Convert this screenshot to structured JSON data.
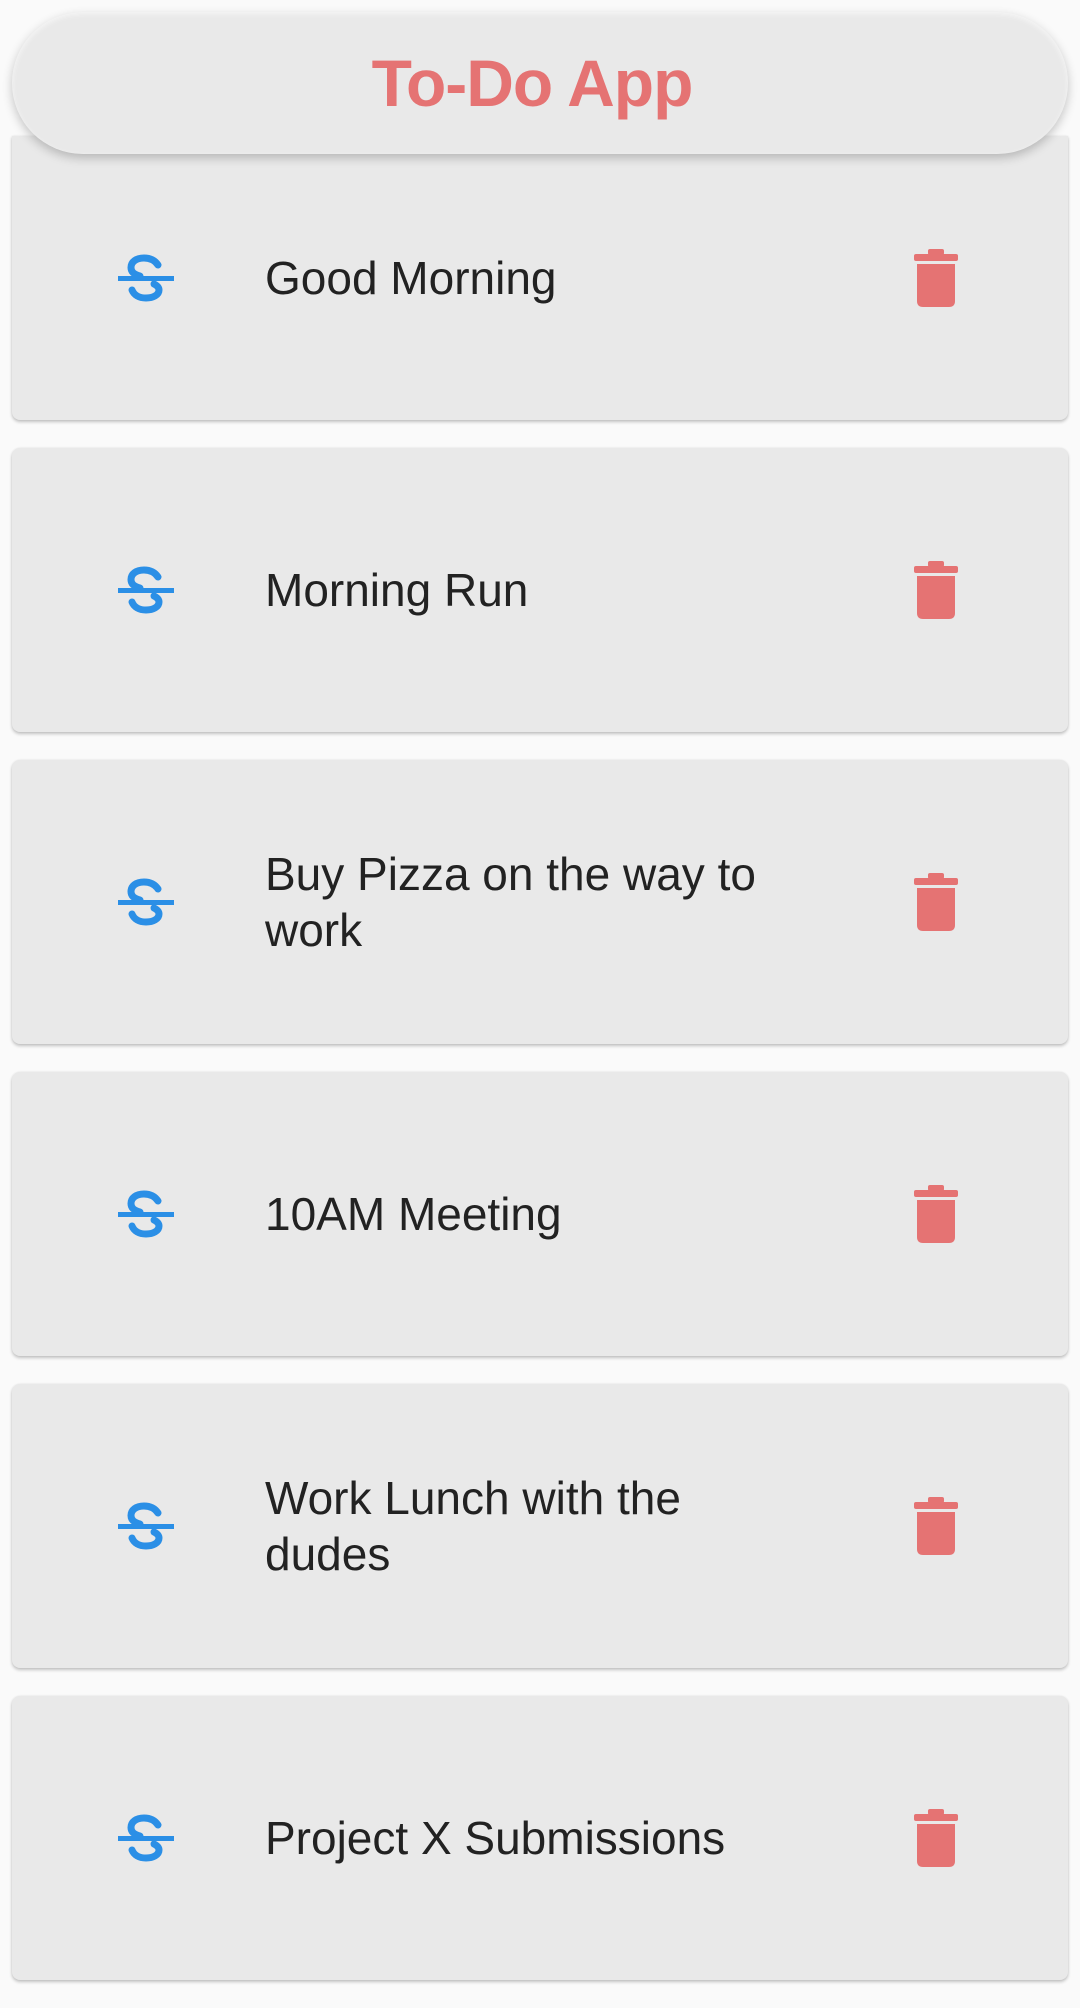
{
  "header": {
    "title": "To-Do App"
  },
  "colors": {
    "accent_red": "#e57373",
    "strike_blue": "#2b8fe6",
    "card_bg": "#e9e9e9",
    "text": "#222222"
  },
  "icons": {
    "strike": "strikethrough-icon",
    "delete": "trash-icon"
  },
  "tasks": [
    {
      "text": "Good Morning"
    },
    {
      "text": "Morning Run"
    },
    {
      "text": "Buy Pizza on the way to work"
    },
    {
      "text": "10AM Meeting"
    },
    {
      "text": "Work Lunch with the dudes"
    },
    {
      "text": "Project X Submissions"
    }
  ]
}
